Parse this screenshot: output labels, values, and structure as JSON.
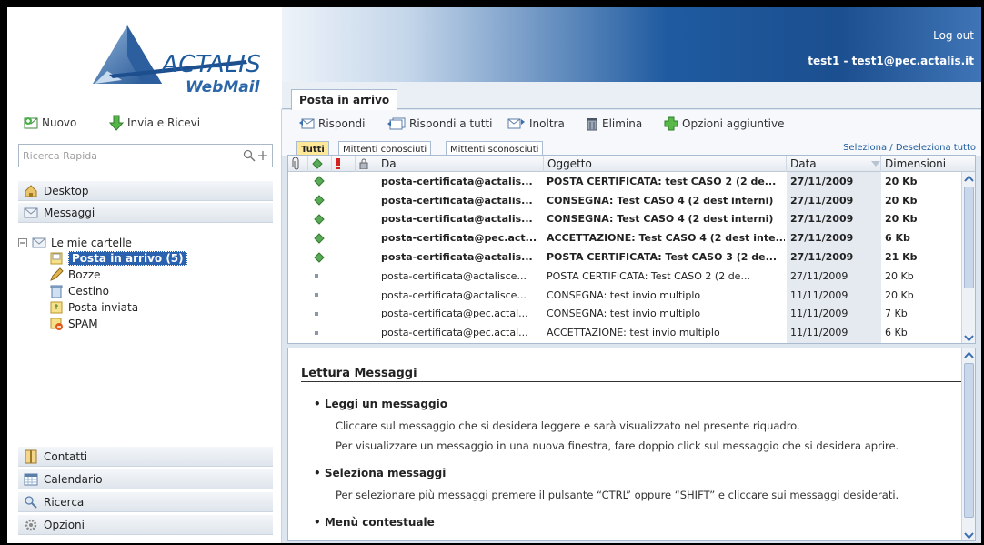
{
  "header": {
    "logout": "Log out",
    "user": "test1 - test1@pec.actalis.it"
  },
  "logo": {
    "brand": "ACTALIS",
    "product": "WebMail"
  },
  "sidebar": {
    "new_label": "Nuovo",
    "send_receive_label": "Invia e Ricevi",
    "search_placeholder": "Ricerca Rapida",
    "nav_top": [
      "Desktop",
      "Messaggi"
    ],
    "folders_root": "Le mie cartelle",
    "folders": [
      "Posta in arrivo (5)",
      "Bozze",
      "Cestino",
      "Posta inviata",
      "SPAM"
    ],
    "nav_bottom": [
      "Contatti",
      "Calendario",
      "Ricerca",
      "Opzioni"
    ]
  },
  "main": {
    "tab": "Posta in arrivo",
    "toolbar": [
      "Rispondi",
      "Rispondi a tutti",
      "Inoltra",
      "Elimina",
      "Opzioni aggiuntive"
    ],
    "filters": [
      "Tutti",
      "Mittenti conosciuti",
      "Mittenti sconosciuti"
    ],
    "select_all": "Seleziona / Deseleziona tutto",
    "columns": {
      "from": "Da",
      "subject": "Oggetto",
      "date": "Data",
      "size": "Dimensioni"
    },
    "messages": [
      {
        "from": "posta-certificata@actalis...",
        "subject": "POSTA CERTIFICATA: test CASO 2 (2 de...",
        "date": "27/11/2009",
        "size": "20 Kb",
        "unread": true
      },
      {
        "from": "posta-certificata@actalis...",
        "subject": "CONSEGNA: Test CASO 4 (2 dest interni)",
        "date": "27/11/2009",
        "size": "20 Kb",
        "unread": true
      },
      {
        "from": "posta-certificata@actalis...",
        "subject": "CONSEGNA: Test CASO 4 (2 dest interni)",
        "date": "27/11/2009",
        "size": "20 Kb",
        "unread": true
      },
      {
        "from": "posta-certificata@pec.act...",
        "subject": "ACCETTAZIONE: Test CASO 4 (2 dest inte...",
        "date": "27/11/2009",
        "size": "6 Kb",
        "unread": true
      },
      {
        "from": "posta-certificata@actalis...",
        "subject": "POSTA CERTIFICATA: Test CASO 3 (2 de...",
        "date": "27/11/2009",
        "size": "21 Kb",
        "unread": true
      },
      {
        "from": "posta-certificata@actalisce...",
        "subject": "POSTA CERTIFICATA: Test CASO 2 (2 de...",
        "date": "27/11/2009",
        "size": "20 Kb",
        "unread": false
      },
      {
        "from": "posta-certificata@actalisce...",
        "subject": "CONSEGNA: test invio multiplo",
        "date": "11/11/2009",
        "size": "20 Kb",
        "unread": false
      },
      {
        "from": "posta-certificata@pec.actal...",
        "subject": "CONSEGNA: test invio multiplo",
        "date": "11/11/2009",
        "size": "7 Kb",
        "unread": false
      },
      {
        "from": "posta-certificata@pec.actal...",
        "subject": "ACCETTAZIONE: test invio multiplo",
        "date": "11/11/2009",
        "size": "6 Kb",
        "unread": false
      }
    ]
  },
  "reader": {
    "title": "Lettura Messaggi",
    "s1_title": "Leggi un messaggio",
    "s1_p1": "Cliccare sul messaggio che si desidera leggere e sarà visualizzato nel presente riquadro.",
    "s1_p2": "Per visualizzare un messaggio in una nuova finestra, fare doppio click sul messaggio che si desidera aprire.",
    "s2_title": "Seleziona messaggi",
    "s2_p1": "Per selezionare più messaggi premere il pulsante “CTRL” oppure “SHIFT” e cliccare sui messaggi desiderati.",
    "s3_title": "Menù contestuale"
  },
  "colors": {
    "accent": "#2a62b0",
    "unread_icon": "#5aa85a"
  }
}
